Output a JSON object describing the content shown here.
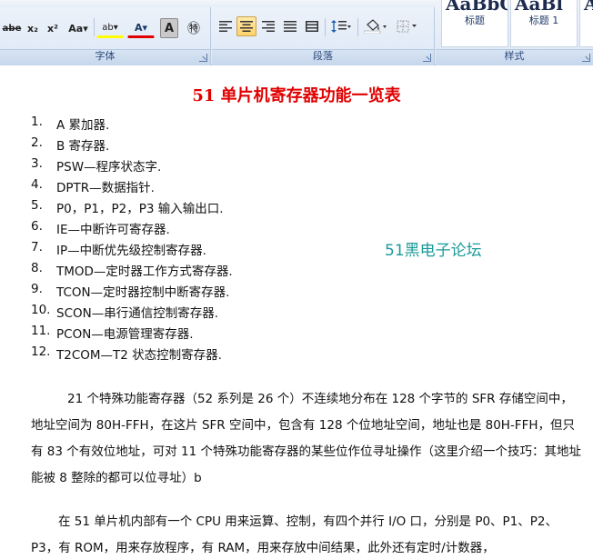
{
  "ribbon": {
    "font_group_label": "字体",
    "paragraph_group_label": "段落",
    "styles_group_label": "样式",
    "font_buttons": {
      "strikethrough": "abe",
      "subscript": "x₂",
      "superscript": "x²",
      "change_case": "Aa▾",
      "highlight": "ab▾",
      "font_color": "A▾",
      "char_shading": "A",
      "enclose": "㊕"
    },
    "styles": [
      {
        "sample": "AaBbC",
        "name": "标题"
      },
      {
        "sample": "AaBl",
        "name": "标题 1"
      },
      {
        "sample": "A",
        "name": ""
      }
    ]
  },
  "document": {
    "title": "51 单片机寄存器功能一览表",
    "list": [
      {
        "num": "1.",
        "text": "A 累加器."
      },
      {
        "num": "2.",
        "text": "B 寄存器."
      },
      {
        "num": "3.",
        "text": "PSW—程序状态字."
      },
      {
        "num": "4.",
        "text": "DPTR—数据指针."
      },
      {
        "num": "5.",
        "text": "P0，P1，P2，P3 输入输出口."
      },
      {
        "num": "6.",
        "text": "IE—中断许可寄存器."
      },
      {
        "num": "7.",
        "text": "IP—中断优先级控制寄存器."
      },
      {
        "num": "8.",
        "text": "TMOD—定时器工作方式寄存器."
      },
      {
        "num": "9.",
        "text": "TCON—定时器控制中断寄存器."
      },
      {
        "num": "10.",
        "text": "SCON—串行通信控制寄存器."
      },
      {
        "num": "11.",
        "text": "PCON—电源管理寄存器."
      },
      {
        "num": "12.",
        "text": "T2COM—T2 状态控制寄存器."
      }
    ],
    "watermark": "51黑电子论坛",
    "paragraph1": "21 个特殊功能寄存器（52 系列是 26 个）不连续地分布在 128 个字节的 SFR 存储空间中，地址空间为 80H-FFH，在这片 SFR 空间中，包含有 128 个位地址空间，地址也是 80H-FFH，但只有 83 个有效位地址，可对 11 个特殊功能寄存器的某些位作位寻址操作（这里介绍一个技巧：其地址能被 8 整除的都可以位寻址）b",
    "paragraph2": "在 51 单片机内部有一个 CPU 用来运算、控制，有四个并行 I/O 口，分别是 P0、P1、P2、P3，有 ROM，用来存放程序，有 RAM，用来存放中间结果，此外还有定时/计数器，"
  },
  "colors": {
    "title": "#e00000",
    "watermark": "#1a9a9a",
    "ribbon_bg": "#dde8f6",
    "active_button": "#ffd26a"
  }
}
